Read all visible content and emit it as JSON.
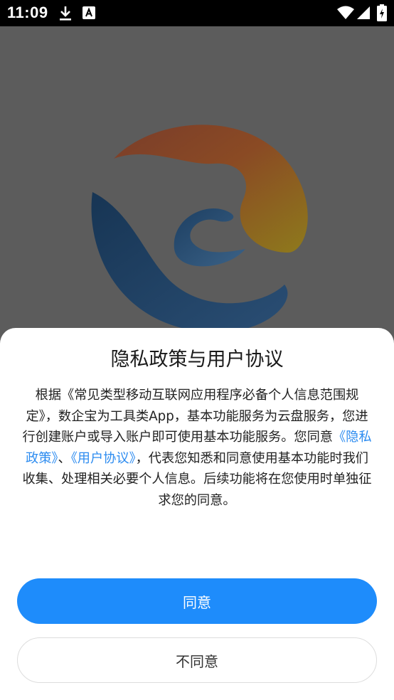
{
  "status_bar": {
    "time": "11:09",
    "icons": [
      "download-icon",
      "font-icon",
      "wifi-icon",
      "signal-icon",
      "battery-charging-icon"
    ]
  },
  "colors": {
    "accent": "#1e8cfb",
    "link": "#2d8cf0",
    "backdrop": "#5c5c5c"
  },
  "logo": {
    "icon": "app-logo-icon"
  },
  "dialog": {
    "title": "隐私政策与用户协议",
    "body": {
      "part1": "根据《常见类型移动互联网应用程序必备个人信息范围规定》，数企宝为工具类App，基本功能服务为云盘服务，您进行创建账户或导入账户即可使用基本功能服务。您同意",
      "privacy_link": "《隐私政策》",
      "separator": "、",
      "agreement_link": "《用户协议》",
      "part2": "，代表您知悉和同意使用基本功能时我们收集、处理相关必要个人信息。后续功能将在您使用时单独征求您的同意。"
    },
    "agree_label": "同意",
    "disagree_label": "不同意"
  }
}
